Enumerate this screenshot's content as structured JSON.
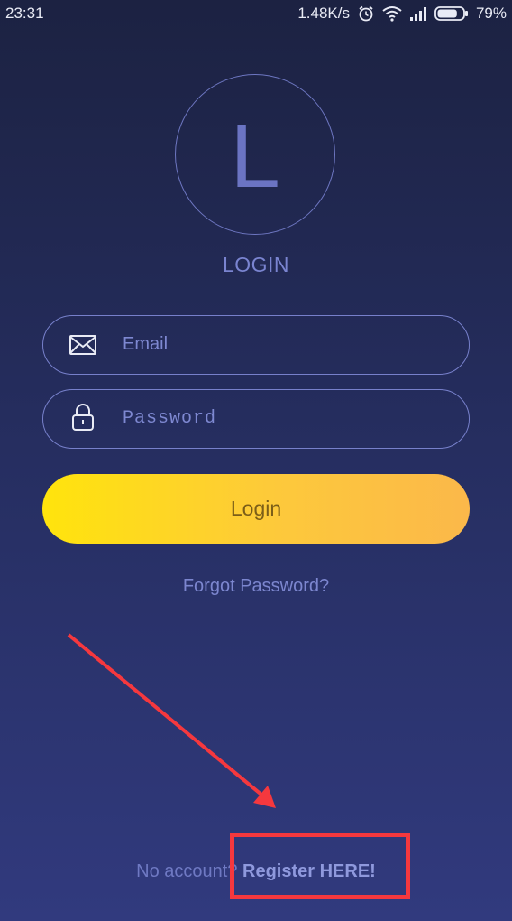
{
  "status_bar": {
    "time": "23:31",
    "network_speed": "1.48K/s",
    "battery_percent": "79%",
    "battery_level": 0.79,
    "icons": [
      "alarm-icon",
      "wifi-icon",
      "signal-icon",
      "battery-icon"
    ]
  },
  "avatar": {
    "letter": "L"
  },
  "login_title": "LOGIN",
  "email_field": {
    "placeholder": "Email",
    "value": "",
    "icon": "envelope-icon"
  },
  "password_field": {
    "placeholder": "Password",
    "value": "",
    "icon": "lock-icon"
  },
  "login_button": {
    "label": "Login"
  },
  "forgot_password": "Forgot Password?",
  "register": {
    "prefix": "No account? ",
    "link_label": "Register HERE!"
  },
  "annotation": {
    "color": "#f5383e"
  },
  "colors": {
    "accent": "#7780cb",
    "button_start": "#ffe40c",
    "button_end": "#fbb84a"
  }
}
